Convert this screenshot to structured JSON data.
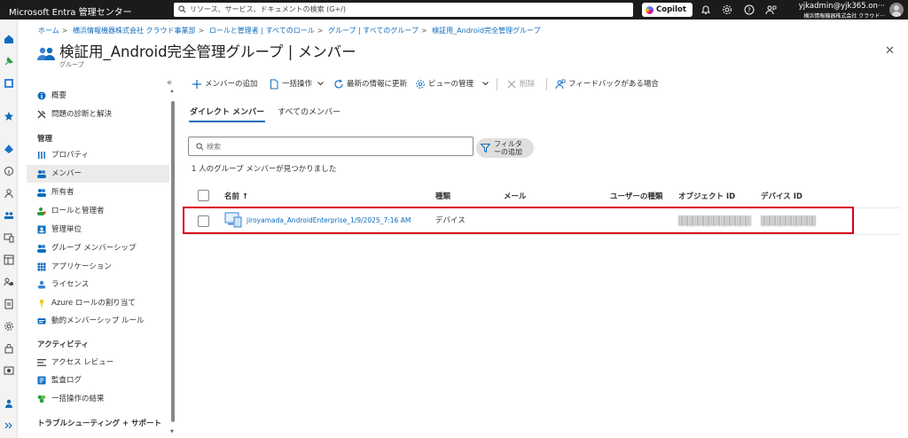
{
  "topbar": {
    "brand": "Microsoft Entra 管理センター",
    "search_placeholder": "リソース、サービス、ドキュメントの検索 (G+/)",
    "copilot_label": "Copilot",
    "account_user": "yjkadmin@yjk365.on···",
    "account_tenant": "横浜情報機器株式会社 クラウド···",
    "icons": [
      "bell-icon",
      "gear-icon",
      "help-icon",
      "feedback-icon"
    ]
  },
  "breadcrumb": [
    "ホーム",
    "横浜情報機器株式会社 クラウド事業部",
    "ロールと管理者 | すべてのロール",
    "グループ | すべてのグループ",
    "検証用_Android完全管理グループ"
  ],
  "page": {
    "title": "検証用_Android完全管理グループ | メンバー",
    "more": "···",
    "subtitle": "グループ",
    "close": "✕"
  },
  "nav": {
    "collapse": "«",
    "top_items": [
      {
        "label": "概要",
        "icon": "info-icon"
      },
      {
        "label": "問題の診断と解決",
        "icon": "wrench-icon"
      }
    ],
    "section_manage": "管理",
    "manage_items": [
      {
        "label": "プロパティ",
        "icon": "properties-icon"
      },
      {
        "label": "メンバー",
        "icon": "members-icon"
      },
      {
        "label": "所有者",
        "icon": "owners-icon"
      },
      {
        "label": "ロールと管理者",
        "icon": "roles-icon"
      },
      {
        "label": "管理単位",
        "icon": "admin-units-icon"
      },
      {
        "label": "グループ メンバーシップ",
        "icon": "group-membership-icon"
      },
      {
        "label": "アプリケーション",
        "icon": "applications-icon"
      },
      {
        "label": "ライセンス",
        "icon": "licenses-icon"
      },
      {
        "label": "Azure ロールの割り当て",
        "icon": "key-icon"
      },
      {
        "label": "動的メンバーシップ ルール",
        "icon": "dynamic-rules-icon"
      }
    ],
    "section_activity": "アクティビティ",
    "activity_items": [
      {
        "label": "アクセス レビュー",
        "icon": "access-review-icon"
      },
      {
        "label": "監査ログ",
        "icon": "audit-log-icon"
      },
      {
        "label": "一括操作の結果",
        "icon": "bulk-results-icon"
      }
    ],
    "section_troubleshoot": "トラブルシューティング + サポート"
  },
  "toolbar": {
    "add_members": "メンバーの追加",
    "bulk_ops": "一括操作",
    "refresh": "最新の情報に更新",
    "manage_view": "ビューの管理",
    "delete": "削除",
    "feedback": "フィードバックがある場合"
  },
  "tabs": {
    "direct": "ダイレクト メンバー",
    "all": "すべてのメンバー"
  },
  "search": {
    "placeholder": "検索",
    "filter_label": "フィルタ\nーの追加"
  },
  "result_count": "1 人のグループ メンバーが見つかりました",
  "table": {
    "columns": [
      "名前 ↑",
      "種類",
      "メール",
      "ユーザーの種類",
      "オブジェクト ID",
      "デバイス ID"
    ],
    "rows": [
      {
        "name": "jiroyamada_AndroidEnterprise_1/9/2025_7:16 AM",
        "type": "デバイス",
        "email": "",
        "user_type": "",
        "object_id": "",
        "device_id": ""
      }
    ]
  },
  "colors": {
    "accent": "#0f6cbd",
    "highlight_border": "#d9001b",
    "topbar": "#1b1b1b"
  }
}
